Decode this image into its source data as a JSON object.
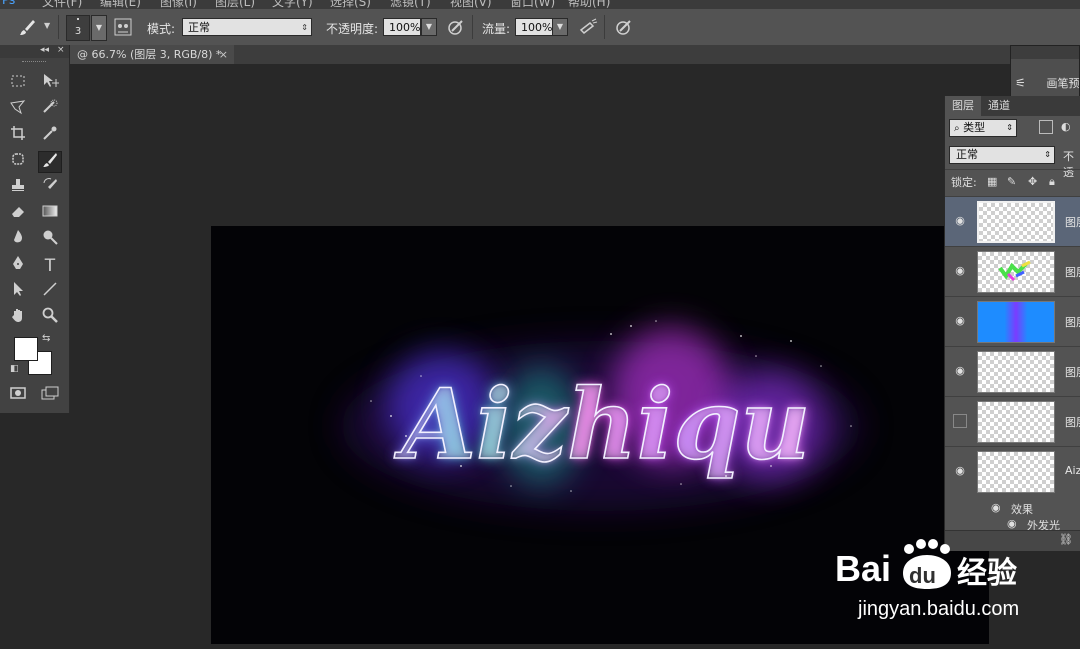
{
  "menu": [
    "文件(F)",
    "编辑(E)",
    "图像(I)",
    "图层(L)",
    "文字(Y)",
    "选择(S)",
    "滤镜(T)",
    "视图(V)",
    "窗口(W)",
    "帮助(H)"
  ],
  "options_bar": {
    "brush_size": "3",
    "mode_label": "模式:",
    "mode_value": "正常",
    "opacity_label": "不透明度:",
    "opacity_value": "100%",
    "flow_label": "流量:",
    "flow_value": "100%"
  },
  "document_tab": {
    "title": "@ 66.7% (图层 3, RGB/8) *",
    "close": "×"
  },
  "toolbox": {
    "collapse": "◂◂",
    "close": "×"
  },
  "canvas": {
    "text": "Aizhiqu"
  },
  "brush_panel": {
    "items": [
      "画笔预",
      "画笔"
    ]
  },
  "layers_panel": {
    "tabs": [
      "图层",
      "通道"
    ],
    "filter_label": "类型",
    "blend_mode": "正常",
    "opacity_label": "不透",
    "lock_label": "锁定:",
    "layers": [
      {
        "name": "图层",
        "visible": true,
        "selected": true
      },
      {
        "name": "图层",
        "visible": true,
        "selected": false
      },
      {
        "name": "图层",
        "visible": true,
        "selected": false
      },
      {
        "name": "图层",
        "visible": true,
        "selected": false
      },
      {
        "name": "图层",
        "visible": false,
        "selected": false
      },
      {
        "name": "Aiz",
        "visible": true,
        "selected": false
      }
    ],
    "effects_label": "效果",
    "effect_item": "外发光"
  },
  "watermark": {
    "brand": "Bai",
    "brand2": "du",
    "brand_cn": "经验",
    "url": "jingyan.baidu.com"
  },
  "colors": {
    "accent_selected_layer": "#5b6678",
    "canvas_bg": "#030306"
  }
}
